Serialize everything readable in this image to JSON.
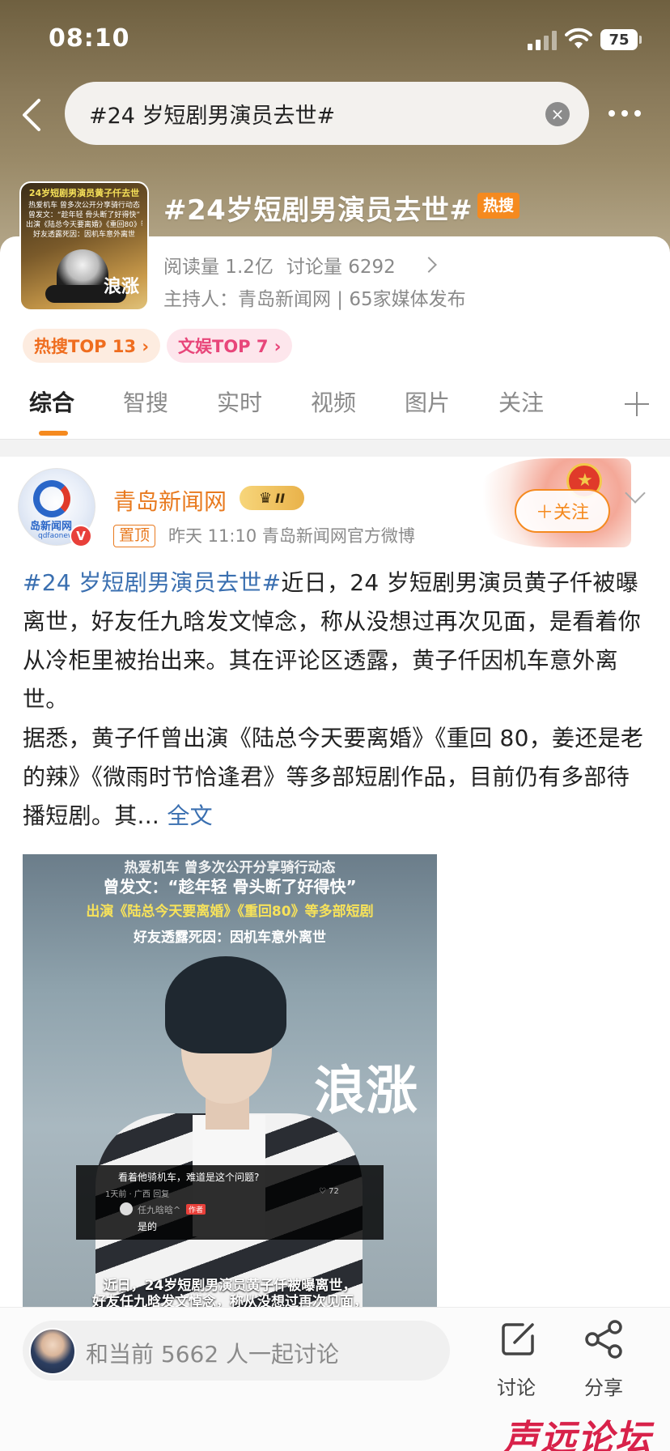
{
  "status_bar": {
    "time": "08:10",
    "battery": "75"
  },
  "nav": {
    "search_text": "#24 岁短剧男演员去世#",
    "clear_glyph": "×"
  },
  "topic": {
    "title": "#24岁短剧男演员去世#",
    "hot_label": "热搜",
    "reads": "阅读量 1.2亿",
    "discussions": "讨论量 6292",
    "host": "主持人：青岛新闻网 | 65家媒体发布",
    "thumb_lines": [
      "24岁短剧男演员黄子仟去世",
      "热爱机车 曾多次公开分享骑行动态",
      "曾发文：“趁年轻 骨头断了好得快”",
      "出演《陆总今天要离婚》《重回80》等多部短剧",
      "好友透露死因：因机车意外离世"
    ],
    "thumb_mark": "浪涨",
    "badges": [
      {
        "label": "热搜TOP 13 ›"
      },
      {
        "label": "文娱TOP 7 ›"
      }
    ]
  },
  "tabs": [
    {
      "label": "综合",
      "active": true
    },
    {
      "label": "智搜"
    },
    {
      "label": "实时"
    },
    {
      "label": "视频"
    },
    {
      "label": "图片"
    },
    {
      "label": "关注"
    }
  ],
  "post": {
    "author": "青岛新闻网",
    "avatar_text": "岛新闻网",
    "avatar_sub": "qdfaonews",
    "verified_glyph": "V",
    "vip_level": "II",
    "pin_label": "置顶",
    "meta": "昨天 11:10  青岛新闻网官方微博",
    "follow_label": "＋关注",
    "hashtag": "#24 岁短剧男演员去世#",
    "text_1": "近日，24 岁短剧男演员黄子仟被曝离世，好友任九晗发文悼念，称从没想过再次见面，是看着你从冷柜里被抬出来。其在评论区透露，黄子仟因机车意外离世。",
    "text_2": "据悉，黄子仟曾出演《陆总今天要离婚》《重回 80，姜还是老的辣》《微雨时节恰逢君》等多部短剧作品，目前仍有多部待播短剧。其...",
    "full_text_link": "全文",
    "image": {
      "caption_1": "热爱机车 曾多次公开分享骑行动态",
      "caption_2": "曾发文：“趁年轻 骨头断了好得快”",
      "caption_3": "出演《陆总今天要离婚》《重回80》等多部短剧",
      "caption_4": "好友透露死因：因机车意外离世",
      "watermark": "浪涨",
      "comment_question": "看着他骑机车，难道是这个问题?",
      "comment_meta": "1天前 · 广西    回复",
      "comment_likes": "♡ 72",
      "reply_user": "任九晗晗^",
      "reply_author_tag": "作者",
      "reply_text": "是的",
      "caption_5": "近日，24岁短剧男演员黄子仟被曝离世，",
      "caption_6": "好友任九晗发文悼念，称从没想过再次见面，"
    }
  },
  "bottom": {
    "discuss_placeholder": "和当前 5662 人一起讨论",
    "discuss_label": "讨论",
    "share_label": "分享"
  },
  "watermark_logo": "声远论坛",
  "colors": {
    "accent": "#f58a1f",
    "link": "#3a6fb0",
    "hot": "#f58a1f"
  },
  "icons": [
    "back-icon",
    "clear-icon",
    "more-icon",
    "plus-icon",
    "chevron-down-icon",
    "edit-icon",
    "share-icon",
    "signal-icon",
    "wifi-icon",
    "battery-icon"
  ]
}
